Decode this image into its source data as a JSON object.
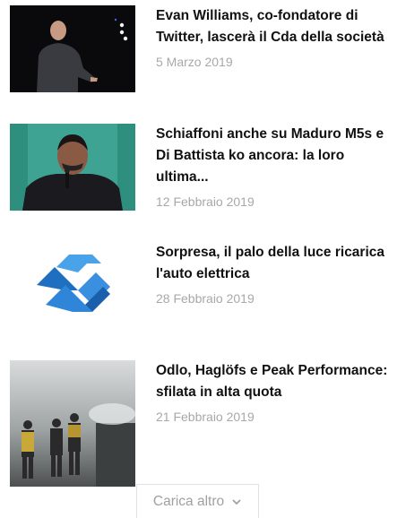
{
  "articles": [
    {
      "title": "Evan Williams, co-fondatore di Twitter, lascerà il Cda della società",
      "date": "5 Marzo 2019",
      "image": "speaker-on-stage-photo"
    },
    {
      "title": "Schiaffoni anche su Maduro M5s e Di Battista ko ancora: la loro ultima...",
      "date": "12 Febbraio 2019",
      "image": "politician-at-microphone-photo"
    },
    {
      "title": "Sorpresa, il palo della luce ricarica l'auto elettrica",
      "date": "28 Febbraio 2019",
      "image": "blue-hexagon-logo"
    },
    {
      "title": "Odlo, Haglöfs e Peak Performance: sfilata in alta quota",
      "date": "21 Febbraio 2019",
      "image": "fashion-show-snow-photo"
    }
  ],
  "load_more": {
    "label": "Carica altro",
    "icon": "chevron-down-icon"
  },
  "colors": {
    "title": "#111111",
    "date": "#a8a8a8",
    "button_text": "#a0a0a0",
    "logo_blue": "#2f7fd0"
  }
}
